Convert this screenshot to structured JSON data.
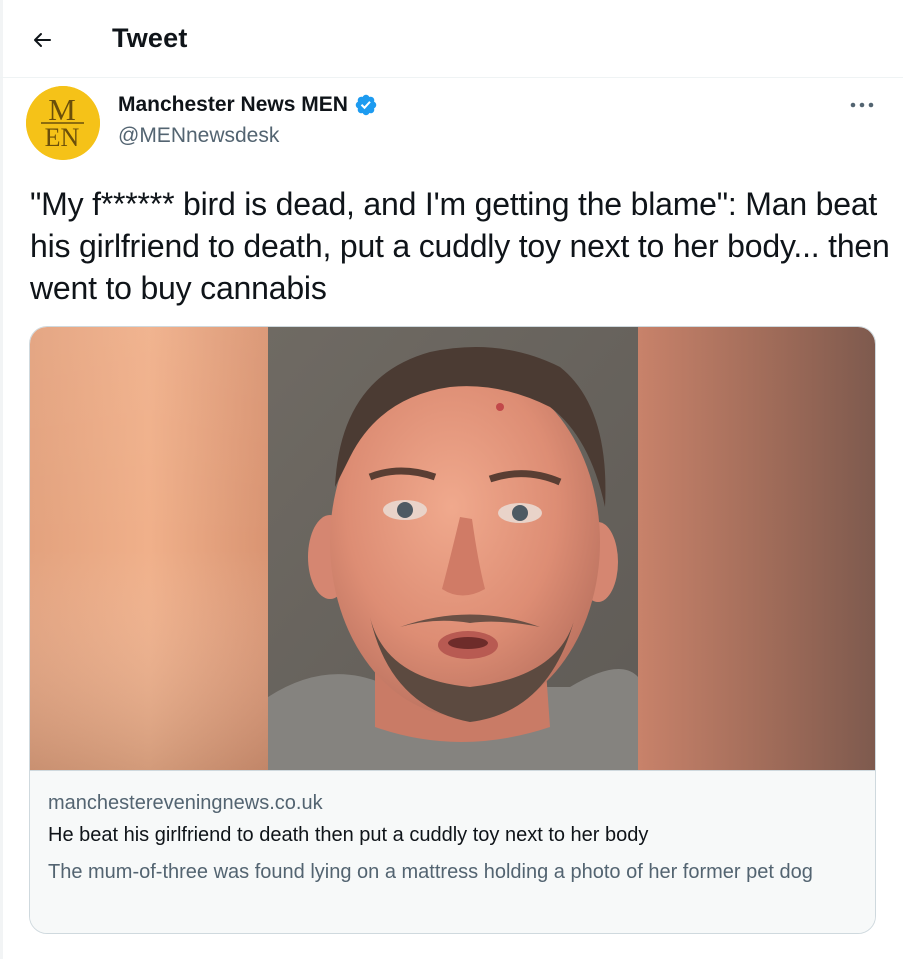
{
  "header": {
    "title": "Tweet",
    "back_icon": "arrow-left-icon"
  },
  "author": {
    "name": "Manchester News MEN",
    "handle": "@MENnewsdesk",
    "verified": true,
    "avatar_text": "MEN",
    "avatar_color": "#f5c218"
  },
  "tweet": {
    "text": "\"My f****** bird is dead, and I'm getting the blame\": Man beat his girlfriend to death, put a cuddly toy next to her body... then went to buy cannabis"
  },
  "card": {
    "domain": "manchestereveningnews.co.uk",
    "title": "He beat his girlfriend to death then put a cuddly toy next to her body",
    "description": "The mum-of-three was found lying on a mattress holding a photo of her former pet dog"
  },
  "colors": {
    "text_primary": "#0f1419",
    "text_secondary": "#536471",
    "verified_blue": "#1d9bf0",
    "border": "#cfd9de",
    "card_footer_bg": "#f7f9f9"
  }
}
